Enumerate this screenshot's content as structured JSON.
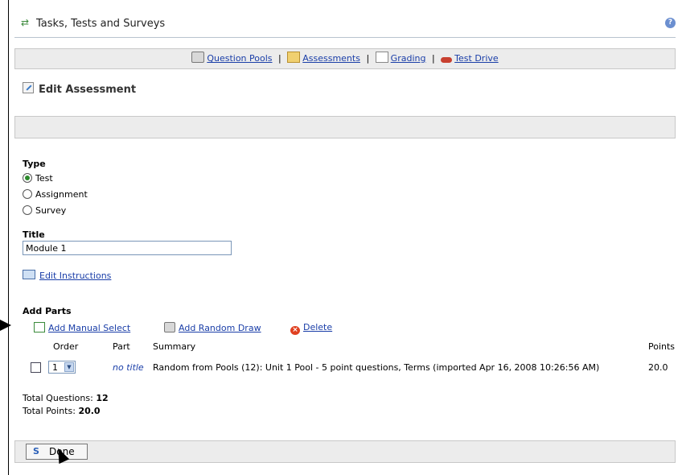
{
  "window": {
    "title": "Tasks, Tests and Surveys"
  },
  "nav": {
    "question_pools": "Question Pools",
    "assessments": "Assessments",
    "grading": "Grading",
    "test_drive": "Test Drive",
    "sep": "|"
  },
  "page": {
    "heading": "Edit Assessment"
  },
  "type": {
    "label": "Type",
    "options": [
      {
        "label": "Test",
        "selected": true
      },
      {
        "label": "Assignment",
        "selected": false
      },
      {
        "label": "Survey",
        "selected": false
      }
    ]
  },
  "title_field": {
    "label": "Title",
    "value": "Module 1"
  },
  "edit_instructions": "Edit Instructions",
  "parts": {
    "label": "Add Parts",
    "actions": {
      "add_manual": "Add Manual Select",
      "add_random": "Add Random Draw",
      "delete": "Delete"
    },
    "columns": {
      "order": "Order",
      "part": "Part",
      "summary": "Summary",
      "points": "Points"
    },
    "rows": [
      {
        "order": "1",
        "part": "no title",
        "summary": "Random from Pools (12): Unit 1 Pool - 5 point questions, Terms (imported Apr 16, 2008 10:26:56 AM)",
        "points": "20.0"
      }
    ]
  },
  "totals": {
    "questions_label": "Total Questions:",
    "questions_value": "12",
    "points_label": "Total Points:",
    "points_value": "20.0"
  },
  "footer": {
    "done": "Done"
  },
  "colors": {
    "link": "#1a3ea8",
    "bar_bg": "#ececec",
    "radio_on": "#2c8a2c"
  }
}
